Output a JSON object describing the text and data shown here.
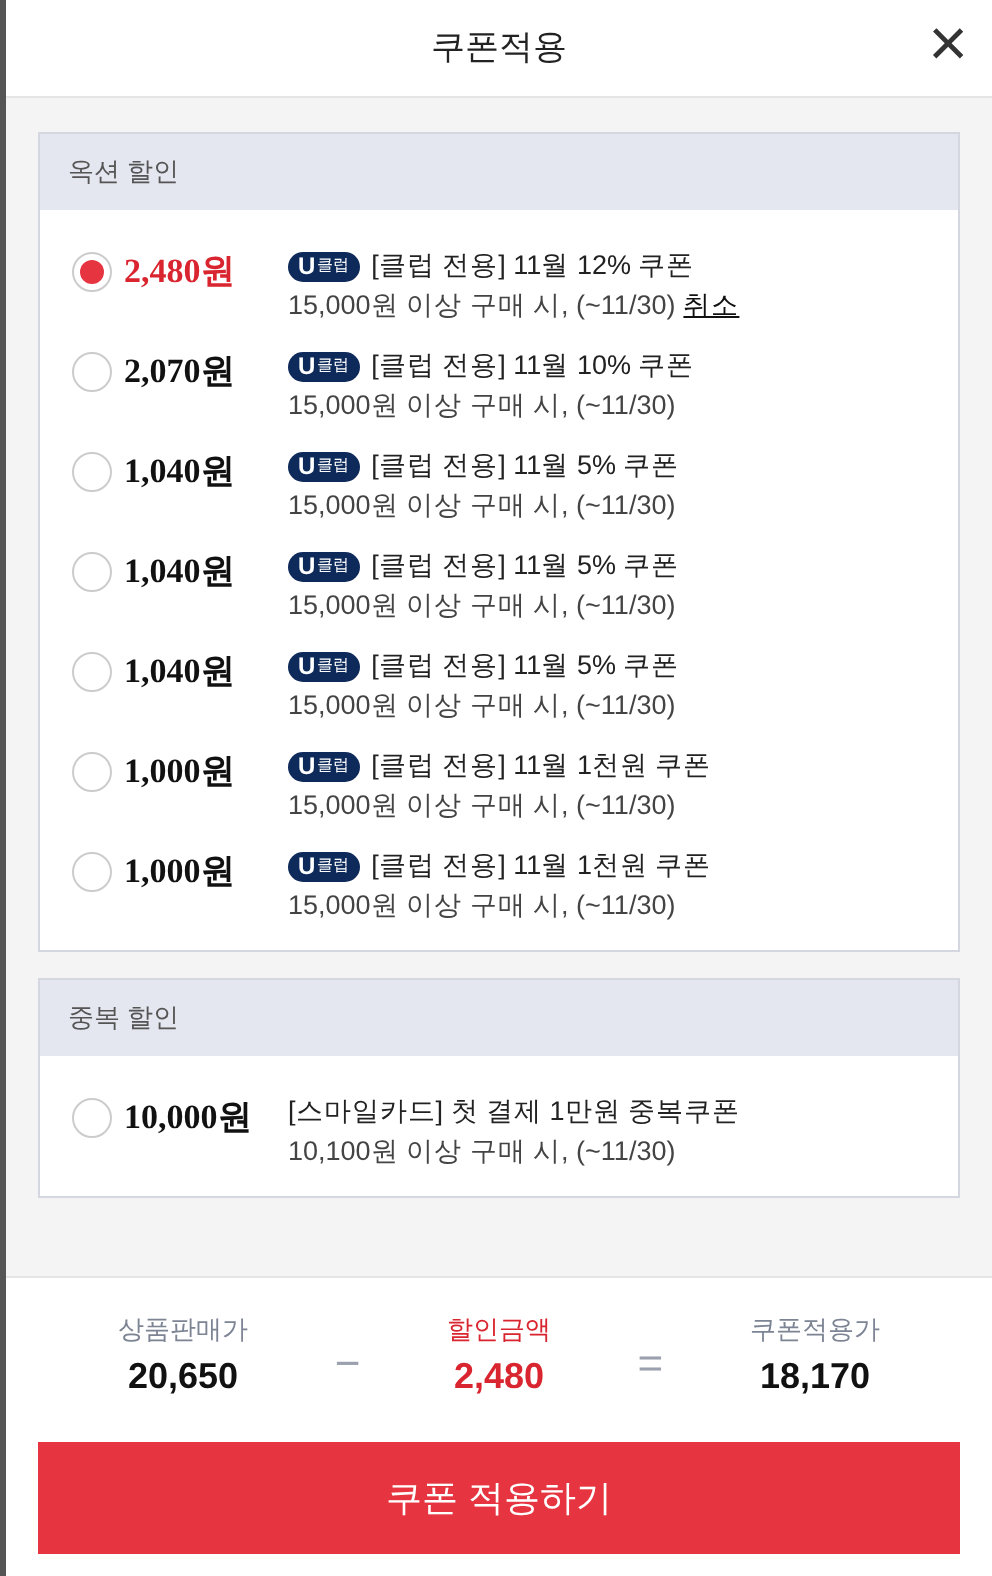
{
  "header": {
    "title": "쿠폰적용",
    "close": "×"
  },
  "sections": [
    {
      "title": "옥션 할인",
      "coupons": [
        {
          "selected": true,
          "amount": "2,480원",
          "badge": {
            "mark": "U",
            "label": "클럽"
          },
          "title": "[클럽 전용] 11월 12% 쿠폰",
          "condition": "15,000원 이상 구매 시, (~11/30)",
          "cancel": "취소"
        },
        {
          "selected": false,
          "amount": "2,070원",
          "badge": {
            "mark": "U",
            "label": "클럽"
          },
          "title": "[클럽 전용] 11월 10% 쿠폰",
          "condition": "15,000원 이상 구매 시, (~11/30)"
        },
        {
          "selected": false,
          "amount": "1,040원",
          "badge": {
            "mark": "U",
            "label": "클럽"
          },
          "title": "[클럽 전용] 11월 5% 쿠폰",
          "condition": "15,000원 이상 구매 시, (~11/30)"
        },
        {
          "selected": false,
          "amount": "1,040원",
          "badge": {
            "mark": "U",
            "label": "클럽"
          },
          "title": "[클럽 전용] 11월 5% 쿠폰",
          "condition": "15,000원 이상 구매 시, (~11/30)"
        },
        {
          "selected": false,
          "amount": "1,040원",
          "badge": {
            "mark": "U",
            "label": "클럽"
          },
          "title": "[클럽 전용] 11월 5% 쿠폰",
          "condition": "15,000원 이상 구매 시, (~11/30)"
        },
        {
          "selected": false,
          "amount": "1,000원",
          "badge": {
            "mark": "U",
            "label": "클럽"
          },
          "title": "[클럽 전용] 11월 1천원 쿠폰",
          "condition": "15,000원 이상 구매 시, (~11/30)"
        },
        {
          "selected": false,
          "amount": "1,000원",
          "badge": {
            "mark": "U",
            "label": "클럽"
          },
          "title": "[클럽 전용] 11월 1천원 쿠폰",
          "condition": "15,000원 이상 구매 시, (~11/30)"
        }
      ]
    },
    {
      "title": "중복 할인",
      "coupons": [
        {
          "selected": false,
          "amount": "10,000원",
          "title": "[스마일카드] 첫 결제 1만원 중복쿠폰",
          "condition": "10,100원 이상 구매 시, (~11/30)"
        }
      ]
    }
  ],
  "summary": {
    "items": [
      {
        "label": "상품판매가",
        "value": "20,650",
        "highlight": false
      },
      {
        "label": "할인금액",
        "value": "2,480",
        "highlight": true
      },
      {
        "label": "쿠폰적용가",
        "value": "18,170",
        "highlight": false
      }
    ],
    "operators": [
      "−",
      "="
    ]
  },
  "apply_button": "쿠폰 적용하기"
}
